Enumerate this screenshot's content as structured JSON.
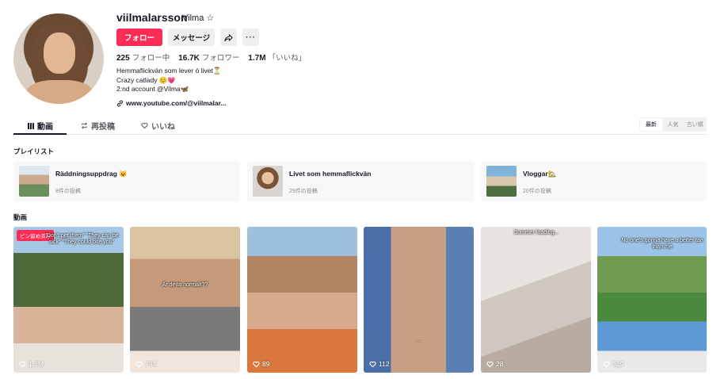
{
  "profile": {
    "username": "viilmalarsson",
    "nickname": "Vilma ☆",
    "buttons": {
      "follow": "フォロー",
      "message": "メッセージ",
      "share_icon": "share-icon",
      "more": "···"
    },
    "stats": {
      "following": {
        "value": "225",
        "label": "フォロー中"
      },
      "followers": {
        "value": "16.7K",
        "label": "フォロワー"
      },
      "likes": {
        "value": "1.7M",
        "label": "「いいね」"
      }
    },
    "bio": [
      "Hemmaflickvän som lever ö livet⏳",
      "Crazy catlady 😊💗",
      "2:nd account @Vilma🦋"
    ],
    "link": "www.youtube.com/@viilmalar..."
  },
  "tabs": [
    {
      "label": "動画",
      "icon": "grid-icon"
    },
    {
      "label": "再投稿",
      "icon": "repost-icon"
    },
    {
      "label": "いいね",
      "icon": "heart-icon"
    }
  ],
  "sort": [
    "最新",
    "人気",
    "古い順"
  ],
  "sections": {
    "playlists": "プレイリスト",
    "videos": "動画"
  },
  "playlists": [
    {
      "title": "Räddningsuppdrag 😺",
      "count": "8件の投稿"
    },
    {
      "title": "Livet som hemmaflickvän",
      "count": "29件の投稿"
    },
    {
      "title": "Vloggar🏡",
      "count": "20件の投稿"
    }
  ],
  "videos": [
    {
      "views": "1.3M",
      "pinned": "ピン留め済み",
      "caption": "\"Don't pet them\" \"They can be sick\" \"They could bite you\""
    },
    {
      "views": "794",
      "caption": "Är detta normalt??"
    },
    {
      "views": "89"
    },
    {
      "views": "112",
      "caption": "..."
    },
    {
      "views": "28",
      "caption": "Summer loading..."
    },
    {
      "views": "329",
      "caption": "No one's gonna have a better tan than me"
    }
  ],
  "colors": {
    "accent": "#fe2c55",
    "text": "#161823",
    "muted": "#8a8b91"
  }
}
